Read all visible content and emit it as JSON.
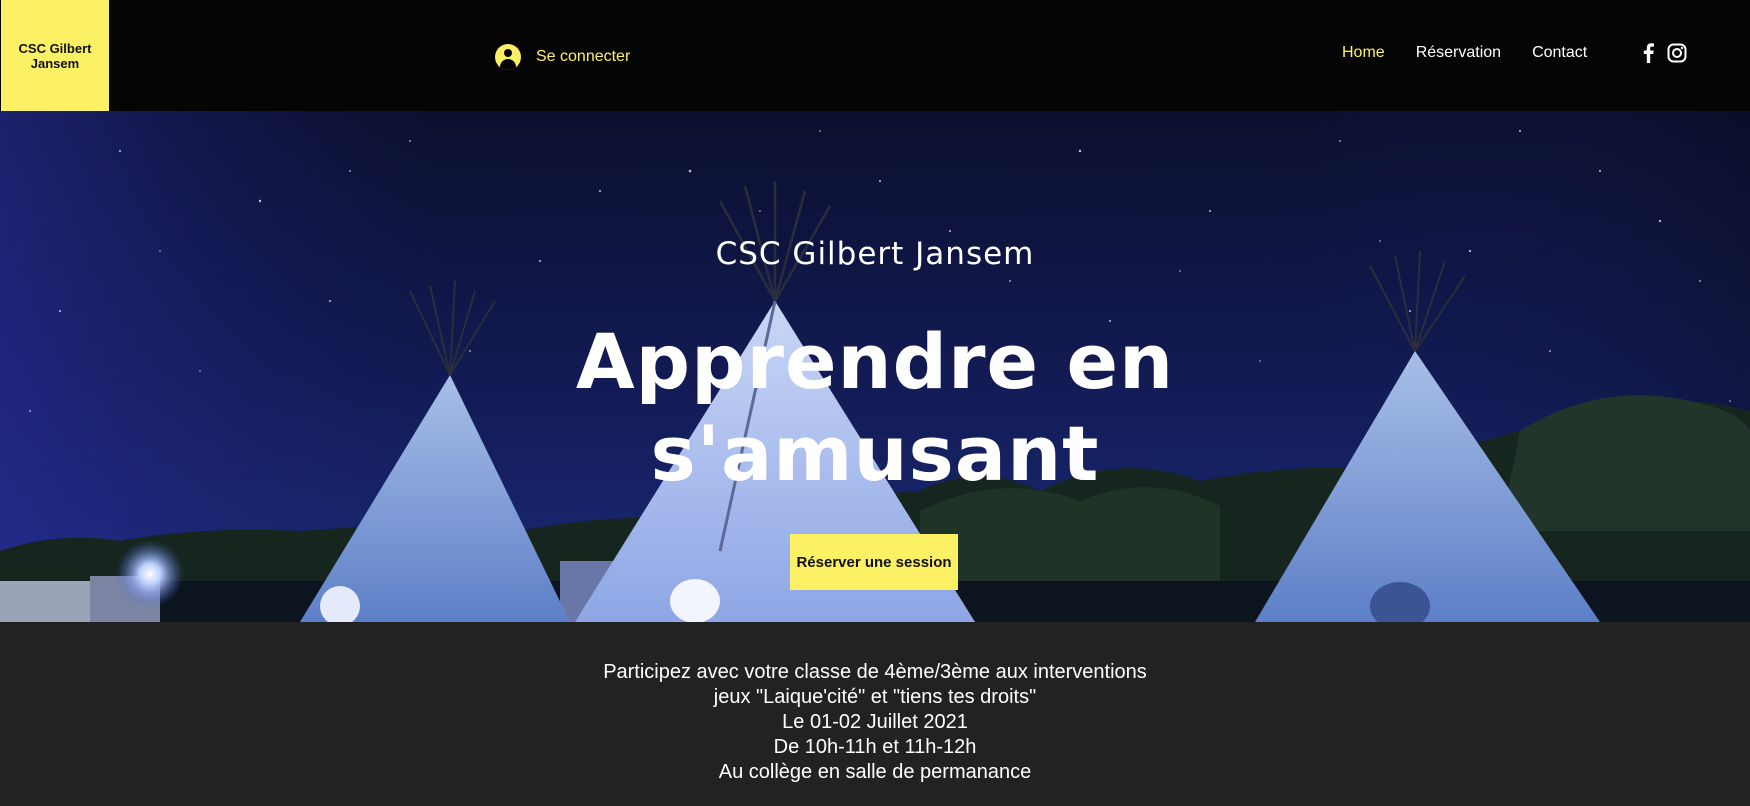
{
  "header": {
    "logo_line1": "CSC Gilbert",
    "logo_line2": "Jansem",
    "login_label": "Se connecter",
    "nav": [
      {
        "label": "Home",
        "active": true
      },
      {
        "label": "Réservation",
        "active": false
      },
      {
        "label": "Contact",
        "active": false
      }
    ],
    "social": [
      "facebook-icon",
      "instagram-icon"
    ]
  },
  "hero": {
    "subtitle": "CSC Gilbert Jansem",
    "title_line1": "Apprendre en",
    "title_line2": "s'amusant",
    "cta_label": "Réserver une session"
  },
  "info": {
    "lines": [
      "Participez avec votre classe de 4ème/3ème aux interventions",
      "jeux \"Laique'cité\" et \"tiens tes droits\"",
      "Le 01-02 Juillet 2021",
      "De 10h-11h et 11h-12h",
      "Au collège en salle de permanance"
    ]
  },
  "colors": {
    "accent": "#fcf064",
    "header_bg": "#050505",
    "info_bg": "#222222",
    "night_sky": "#0e1238"
  }
}
